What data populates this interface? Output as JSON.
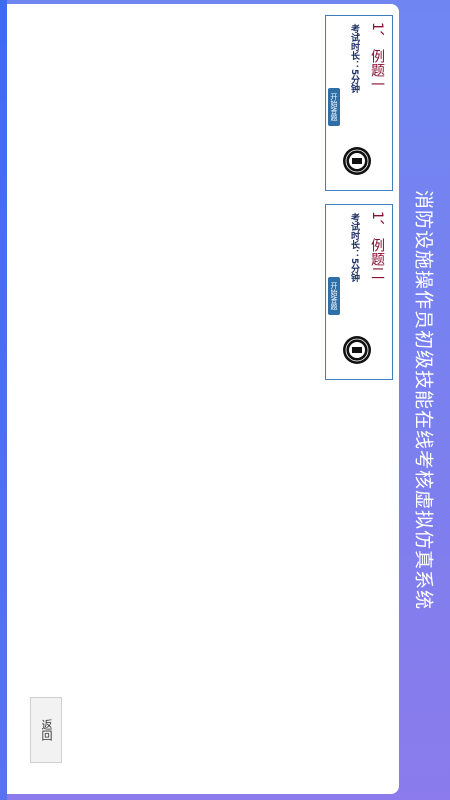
{
  "header": {
    "title": "消防设施操作员初级技能在线考核虚拟仿真系统"
  },
  "exams": [
    {
      "title": "1、 例题一",
      "duration": "考试时长：5分钟",
      "start_label": "开始答题"
    },
    {
      "title": "1、 例题二",
      "duration": "考试时长：5分钟",
      "start_label": "开始答题"
    }
  ],
  "footer": {
    "back_label": "返回"
  },
  "colors": {
    "accent": "#7a80ef",
    "card_border": "#3f7fbf",
    "title_text": "#8a1032",
    "button": "#2f6fa8"
  },
  "icons": {
    "seal": "seal-stamp-icon"
  }
}
